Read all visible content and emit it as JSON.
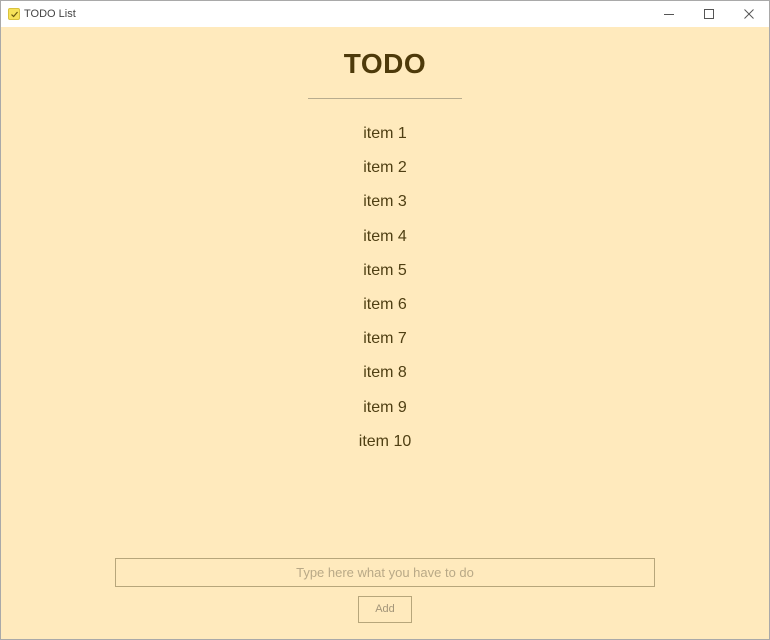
{
  "window": {
    "title": "TODO List",
    "icons": {
      "app": "check-icon",
      "minimize": "minimize-icon",
      "maximize": "maximize-icon",
      "close": "close-icon"
    }
  },
  "main": {
    "heading": "TODO",
    "items": [
      "item 1",
      "item 2",
      "item 3",
      "item 4",
      "item 5",
      "item 6",
      "item 7",
      "item 8",
      "item 9",
      "item 10"
    ],
    "input": {
      "value": "",
      "placeholder": "Type here what you have to do"
    },
    "add_label": "Add"
  },
  "colors": {
    "background": "#ffeabd",
    "heading": "#4e3a0a",
    "item_text": "#4f3f13",
    "border": "#b7a67b",
    "icon": "#f6e25a"
  }
}
